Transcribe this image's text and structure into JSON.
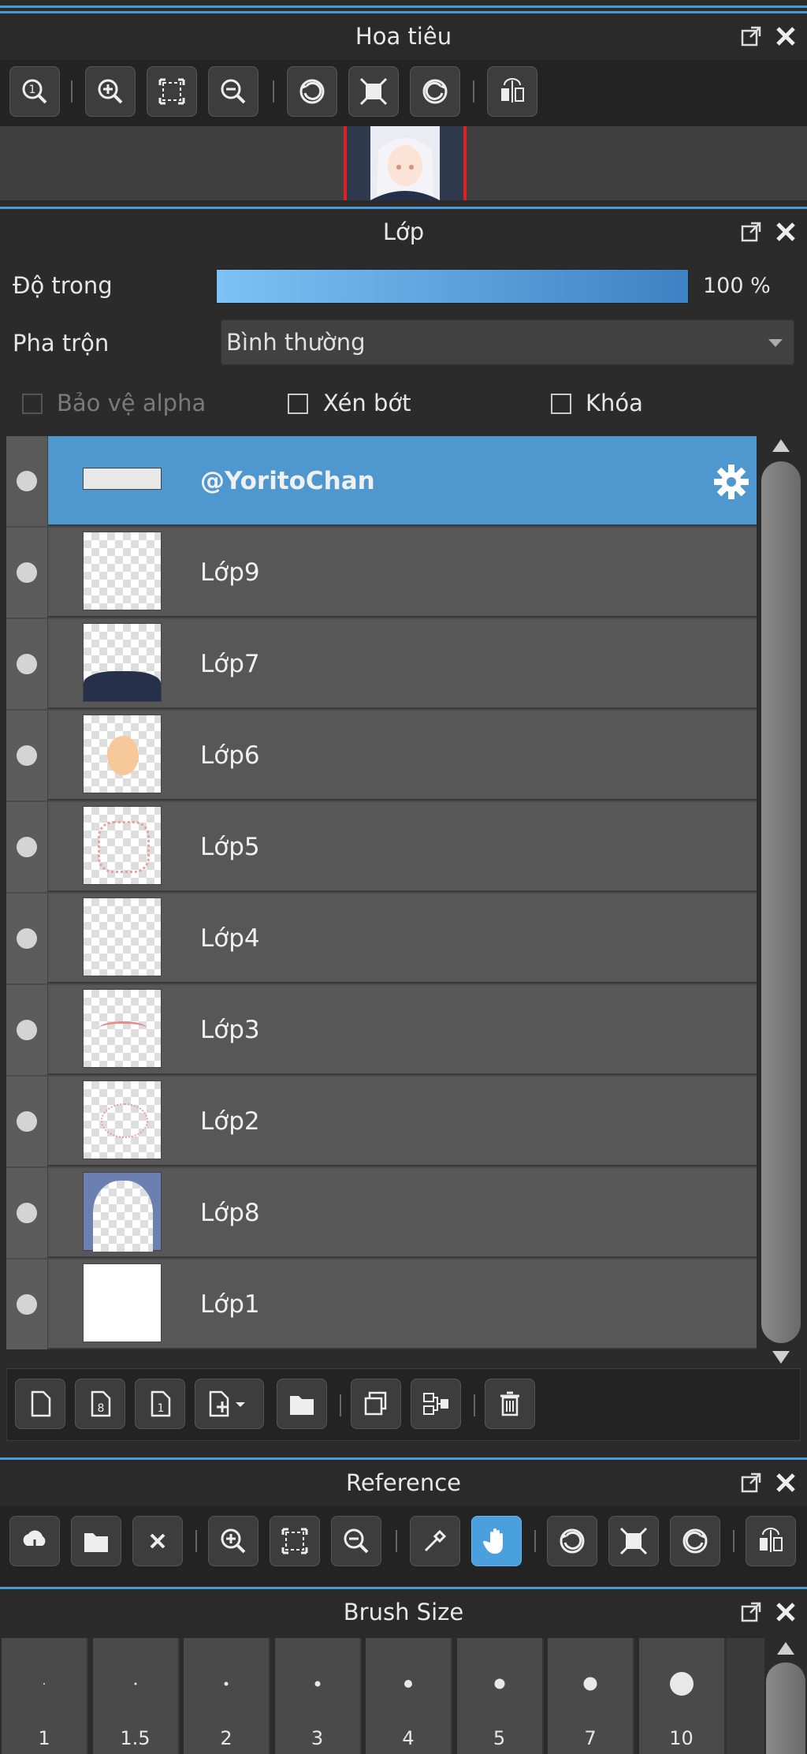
{
  "navigator": {
    "title": "Hoa tiêu"
  },
  "layer_panel": {
    "title": "Lớp",
    "opacity_label": "Độ trong",
    "opacity_value": 100,
    "opacity_text": "100 %",
    "blend_label": "Pha trộn",
    "blend_value": "Bình thường",
    "protect_alpha": "Bảo vệ alpha",
    "clipping": "Xén bớt",
    "lock": "Khóa",
    "layers": [
      {
        "name": "@YoritoChan",
        "selected": true
      },
      {
        "name": "Lớp9"
      },
      {
        "name": "Lớp7"
      },
      {
        "name": "Lớp6"
      },
      {
        "name": "Lớp5"
      },
      {
        "name": "Lớp4"
      },
      {
        "name": "Lớp3"
      },
      {
        "name": "Lớp2"
      },
      {
        "name": "Lớp8"
      },
      {
        "name": "Lớp1"
      }
    ]
  },
  "reference": {
    "title": "Reference"
  },
  "brush_size": {
    "title": "Brush Size",
    "sizes": [
      "1",
      "1.5",
      "2",
      "3",
      "4",
      "5",
      "7",
      "10"
    ]
  },
  "colors": {
    "accent": "#4a9ad6",
    "selected_row": "#4f97cf"
  }
}
